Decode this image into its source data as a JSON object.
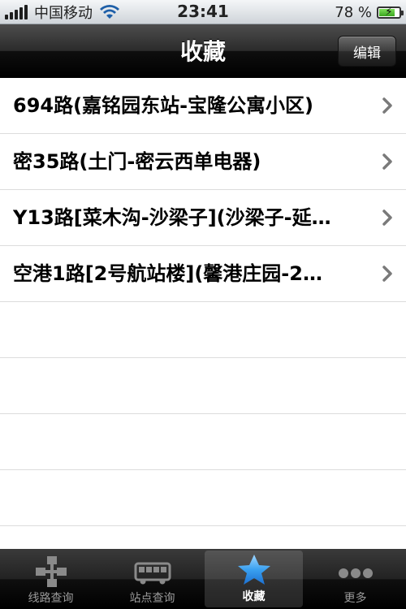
{
  "status_bar": {
    "carrier": "中国移动",
    "time": "23:41",
    "battery_percent": "78 %",
    "battery_level": 0.78
  },
  "nav_bar": {
    "title": "收藏",
    "edit_label": "编辑"
  },
  "favorites": {
    "items": [
      {
        "label": "694路(嘉铭园东站-宝隆公寓小区)"
      },
      {
        "label": "密35路(土门-密云西单电器)"
      },
      {
        "label": "Y13路[菜木沟-沙梁子](沙梁子-延…"
      },
      {
        "label": "空港1路[2号航站楼](馨港庄园-2…"
      }
    ]
  },
  "tab_bar": {
    "tabs": [
      {
        "label": "线路查询",
        "icon": "route-tree-icon"
      },
      {
        "label": "站点查询",
        "icon": "bus-icon"
      },
      {
        "label": "收藏",
        "icon": "star-icon",
        "active": true
      },
      {
        "label": "更多",
        "icon": "more-dots-icon"
      }
    ]
  },
  "colors": {
    "accent_star": "#3aa0f0",
    "nav_bar": "#1a1a1a"
  }
}
